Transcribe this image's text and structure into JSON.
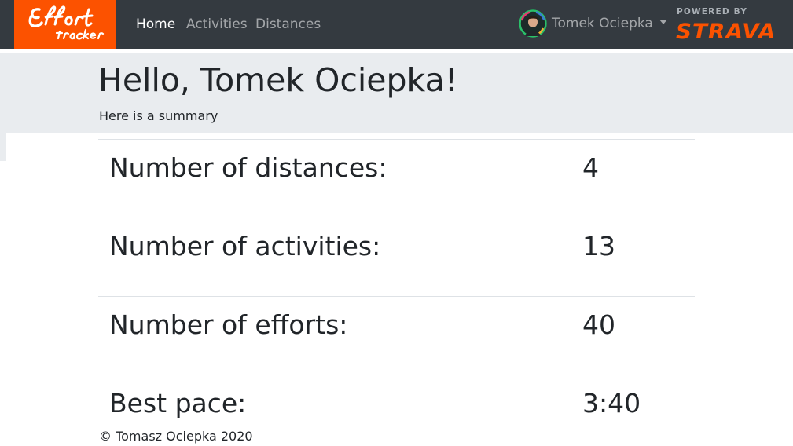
{
  "navbar": {
    "brand_text": "Effort tracker",
    "links": [
      {
        "label": "Home",
        "active": true
      },
      {
        "label": "Activities",
        "active": false
      },
      {
        "label": "Distances",
        "active": false
      }
    ],
    "user": {
      "name": "Tomek Ociepka"
    },
    "strava": {
      "powered_by": "POWERED BY",
      "logo_text": "STRAVA"
    }
  },
  "jumbotron": {
    "greeting": "Hello, Tomek Ociepka!",
    "subtitle": "Here is a summary"
  },
  "summary": [
    {
      "label": "Number of distances:",
      "value": "4"
    },
    {
      "label": "Number of activities:",
      "value": "13"
    },
    {
      "label": "Number of efforts:",
      "value": "40"
    },
    {
      "label": "Best pace:",
      "value": "3:40"
    }
  ],
  "footer": {
    "copyright": "© Tomasz Ociepka 2020"
  },
  "colors": {
    "navbar_bg": "#343a40",
    "brand_orange": "#fc5200",
    "jumbotron_bg": "#e9ecef",
    "text": "#212529"
  }
}
